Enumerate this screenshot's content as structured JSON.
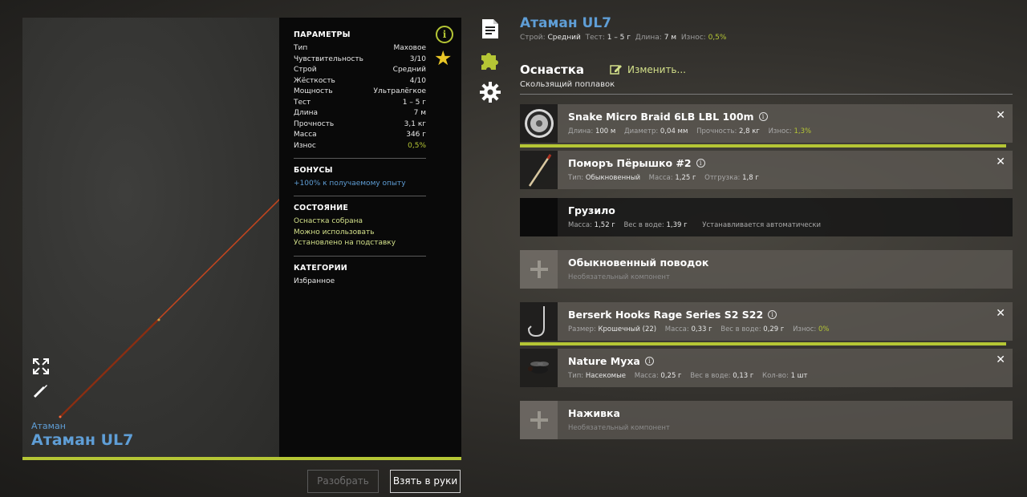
{
  "preview": {
    "brand": "Атаман",
    "name": "Атаман UL7"
  },
  "stats": {
    "params_title": "ПАРАМЕТРЫ",
    "params": [
      {
        "label": "Тип",
        "value": "Маховое"
      },
      {
        "label": "Чувствительность",
        "value": "3/10"
      },
      {
        "label": "Строй",
        "value": "Средний"
      },
      {
        "label": "Жёсткость",
        "value": "4/10"
      },
      {
        "label": "Мощность",
        "value": "Ультралёгкое"
      },
      {
        "label": "Тест",
        "value": "1 – 5 г"
      },
      {
        "label": "Длина",
        "value": "7 м"
      },
      {
        "label": "Прочность",
        "value": "3,1 кг"
      },
      {
        "label": "Масса",
        "value": "346 г"
      },
      {
        "label": "Износ",
        "value": "0,5%"
      }
    ],
    "bonuses_title": "БОНУСЫ",
    "bonus": "+100% к получаемому опыту",
    "state_title": "СОСТОЯНИЕ",
    "states": [
      "Оснастка собрана",
      "Можно использовать",
      "Установлено на подставку"
    ],
    "categories_title": "КАТЕГОРИИ",
    "category": "Избранное"
  },
  "buttons": {
    "disassemble": "Разобрать",
    "take": "Взять в руки"
  },
  "rig": {
    "title": "Атаман UL7",
    "sub": {
      "action_label": "Строй:",
      "action_value": "Средний",
      "test_label": "Тест:",
      "test_value": "1 – 5 г",
      "length_label": "Длина:",
      "length_value": "7 м",
      "wear_label": "Износ:",
      "wear_value": "0,5%"
    }
  },
  "tackle": {
    "heading": "Оснастка",
    "edit_label": "Изменить...",
    "type": "Скользящий поплавок"
  },
  "slots": {
    "line": {
      "name": "Snake Micro Braid 6LB LBL 100m",
      "l1": "Длина:",
      "v1": "100 м",
      "l2": "Диаметр:",
      "v2": "0,04 мм",
      "l3": "Прочность:",
      "v3": "2,8 кг",
      "l4": "Износ:",
      "v4": "1,3%"
    },
    "float": {
      "name": "Поморъ Пёрышко #2",
      "l1": "Тип:",
      "v1": "Обыкновенный",
      "l2": "Масса:",
      "v2": "1,25 г",
      "l3": "Отгрузка:",
      "v3": "1,8 г"
    },
    "sinker": {
      "name": "Грузило",
      "l1": "Масса:",
      "v1": "1,52 г",
      "l2": "Вес в воде:",
      "v2": "1,39 г",
      "note": "Устанавливается автоматически"
    },
    "leader": {
      "name": "Обыкновенный поводок",
      "optional": "Необязательный компонент"
    },
    "hook": {
      "name": "Berserk Hooks Rage Series S2 S22",
      "l1": "Размер:",
      "v1": "Крошечный (22)",
      "l2": "Масса:",
      "v2": "0,33 г",
      "l3": "Вес в воде:",
      "v3": "0,29 г",
      "l4": "Износ:",
      "v4": "0%"
    },
    "bait": {
      "name": "Nature Муха",
      "l1": "Тип:",
      "v1": "Насекомые",
      "l2": "Масса:",
      "v2": "0,25 г",
      "l3": "Вес в воде:",
      "v3": "0,13 г",
      "l4": "Кол-во:",
      "v4": "1 шт"
    },
    "lure": {
      "name": "Наживка",
      "optional": "Необязательный компонент"
    }
  },
  "colors": {
    "accent": "#b5c635",
    "blue": "#5f9ed6",
    "star": "#e9c626"
  }
}
